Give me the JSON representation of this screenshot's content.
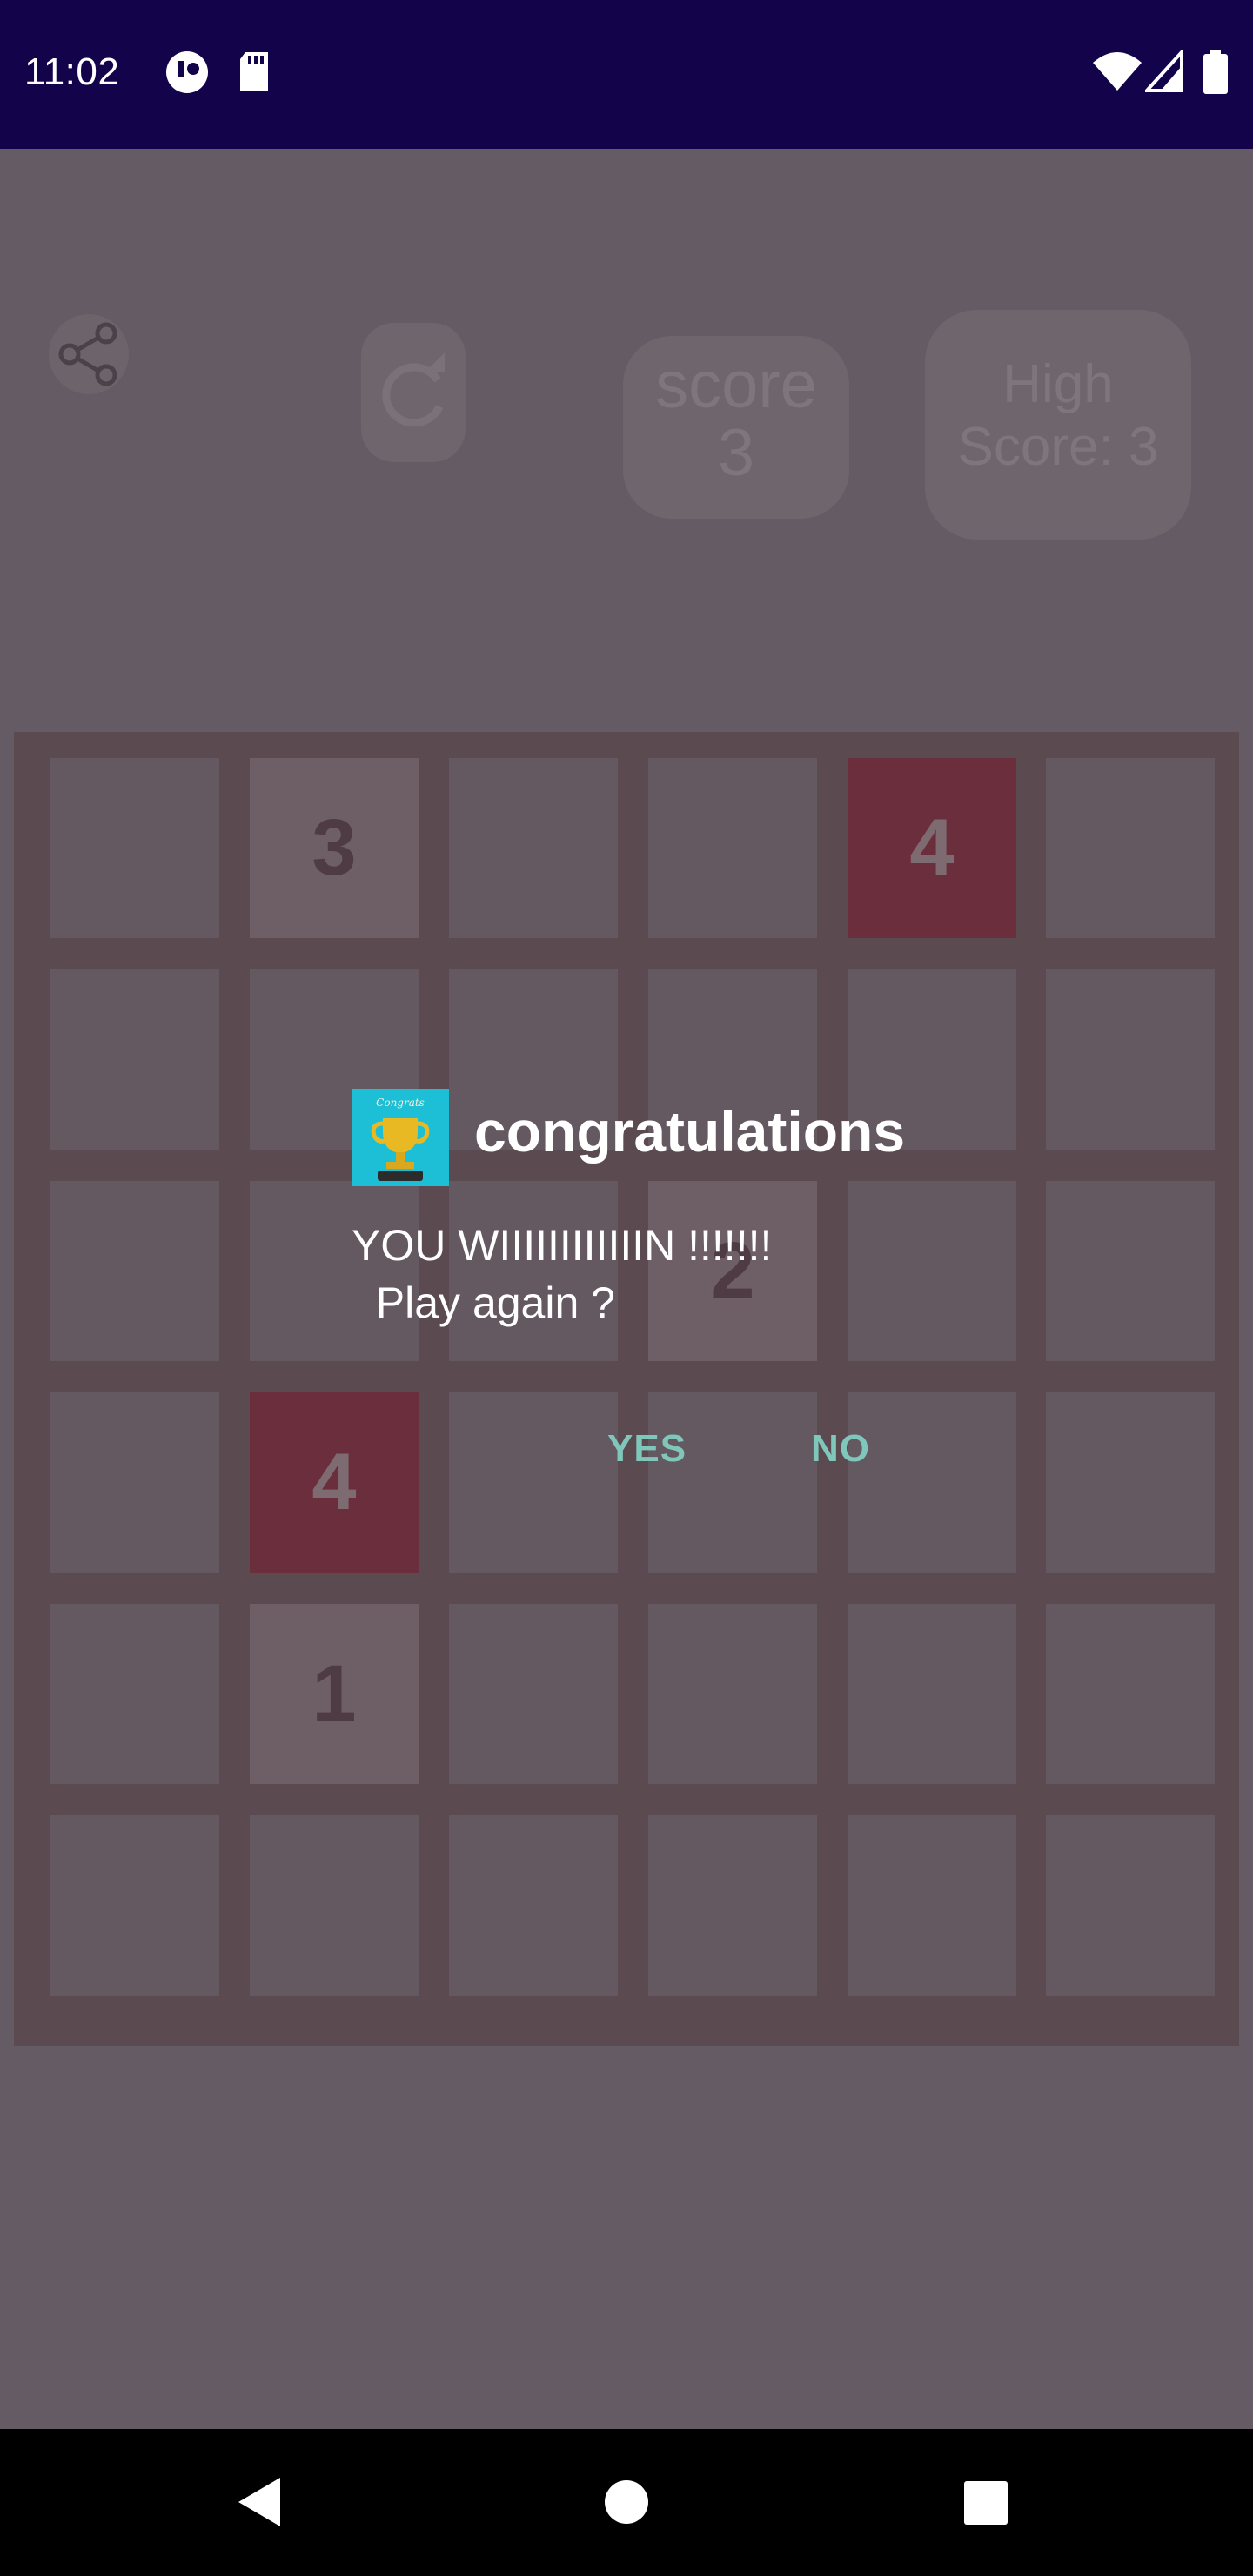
{
  "status_bar": {
    "time": "11:02"
  },
  "header": {
    "score_label": "score",
    "score_value": "3",
    "high_score_line1": "High",
    "high_score_line2": "Score: 3"
  },
  "board": {
    "tiles": [
      {
        "row": 0,
        "col": 1,
        "value": "3",
        "style": "num"
      },
      {
        "row": 0,
        "col": 4,
        "value": "4",
        "style": "dark"
      },
      {
        "row": 2,
        "col": 3,
        "value": "2",
        "style": "num"
      },
      {
        "row": 3,
        "col": 1,
        "value": "4",
        "style": "dark"
      },
      {
        "row": 4,
        "col": 1,
        "value": "1",
        "style": "num"
      }
    ]
  },
  "dialog": {
    "title": "congratulations",
    "message_line1": "YOU WIIIIIIIIIIIIN !!!!!!!",
    "message_line2": "  Play again ?",
    "yes_label": "YES",
    "no_label": "NO",
    "icon": "trophy-icon"
  },
  "colors": {
    "status_bar": "#12034a",
    "scrim_background": "#655b64",
    "dark_tile": "#6b2e3c",
    "dialog_button": "#7fc7ba",
    "dialog_icon_bg": "#1dbfd6"
  }
}
